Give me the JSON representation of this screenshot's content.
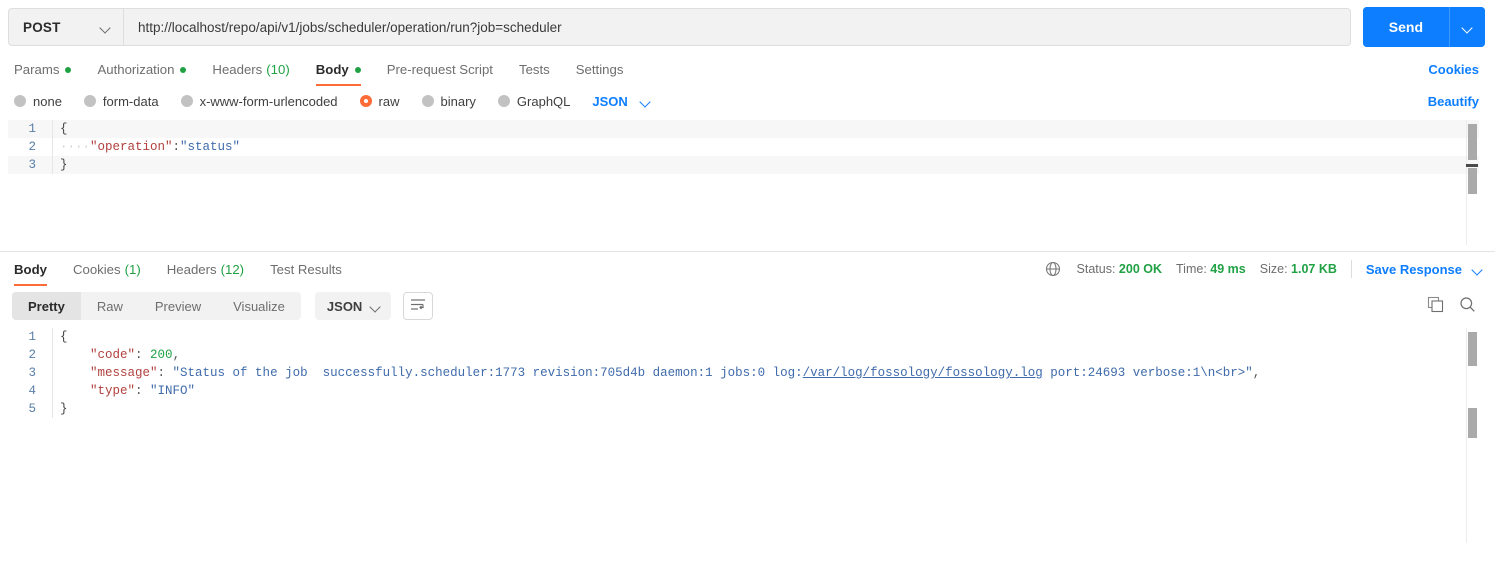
{
  "request": {
    "method": "POST",
    "url": "http://localhost/repo/api/v1/jobs/scheduler/operation/run?job=scheduler",
    "send_label": "Send",
    "cookies_label": "Cookies",
    "beautify_label": "Beautify",
    "tabs": [
      {
        "label": "Params",
        "dot": true,
        "count": "",
        "active": false
      },
      {
        "label": "Authorization",
        "dot": true,
        "count": "",
        "active": false
      },
      {
        "label": "Headers",
        "dot": false,
        "count": "(10)",
        "active": false
      },
      {
        "label": "Body",
        "dot": true,
        "count": "",
        "active": true
      },
      {
        "label": "Pre-request Script",
        "dot": false,
        "count": "",
        "active": false
      },
      {
        "label": "Tests",
        "dot": false,
        "count": "",
        "active": false
      },
      {
        "label": "Settings",
        "dot": false,
        "count": "",
        "active": false
      }
    ],
    "body_types": [
      {
        "label": "none",
        "selected": false
      },
      {
        "label": "form-data",
        "selected": false
      },
      {
        "label": "x-www-form-urlencoded",
        "selected": false
      },
      {
        "label": "raw",
        "selected": true
      },
      {
        "label": "binary",
        "selected": false
      },
      {
        "label": "GraphQL",
        "selected": false
      }
    ],
    "raw_format": "JSON",
    "body_lines": [
      {
        "num": "1",
        "brace": "{"
      },
      {
        "num": "2",
        "indent": "····",
        "key": "\"operation\"",
        "colon": ":",
        "value": "\"status\""
      },
      {
        "num": "3",
        "brace": "}"
      }
    ]
  },
  "response": {
    "tabs": [
      {
        "label": "Body",
        "count": "",
        "active": true
      },
      {
        "label": "Cookies",
        "count": "(1)",
        "active": false
      },
      {
        "label": "Headers",
        "count": "(12)",
        "active": false
      },
      {
        "label": "Test Results",
        "count": "",
        "active": false
      }
    ],
    "status_label": "Status:",
    "status_value": "200 OK",
    "time_label": "Time:",
    "time_value": "49 ms",
    "size_label": "Size:",
    "size_value": "1.07 KB",
    "save_response_label": "Save Response",
    "view_modes": [
      {
        "label": "Pretty",
        "active": true
      },
      {
        "label": "Raw",
        "active": false
      },
      {
        "label": "Preview",
        "active": false
      },
      {
        "label": "Visualize",
        "active": false
      }
    ],
    "format": "JSON",
    "icons": {
      "globe": "globe-icon",
      "wrap": "word-wrap-icon",
      "copy": "copy-icon",
      "search": "search-icon"
    },
    "body_lines": [
      {
        "num": "1",
        "type": "brace",
        "text": "{"
      },
      {
        "num": "2",
        "type": "pair",
        "key": "\"code\"",
        "colon": ": ",
        "value": "200",
        "valtype": "num",
        "tail": ","
      },
      {
        "num": "3",
        "type": "message",
        "key": "\"message\"",
        "colon": ": ",
        "pre": "\"Status of the job  successfully.scheduler:1773 revision:705d4b daemon:1 jobs:0 log:",
        "link": "/var/log/fossology/fossology.log",
        "post": " port:24693 verbose:1\\n<br>\"",
        "tail": ","
      },
      {
        "num": "4",
        "type": "pair",
        "key": "\"type\"",
        "colon": ": ",
        "value": "\"INFO\"",
        "valtype": "str",
        "tail": ""
      },
      {
        "num": "5",
        "type": "brace",
        "text": "}"
      }
    ]
  },
  "colors": {
    "accent": "#ff6c37",
    "link": "#0d7eff",
    "green": "#20a144",
    "json_key": "#b0413e",
    "json_string": "#3f6bab",
    "json_number": "#20a144"
  }
}
